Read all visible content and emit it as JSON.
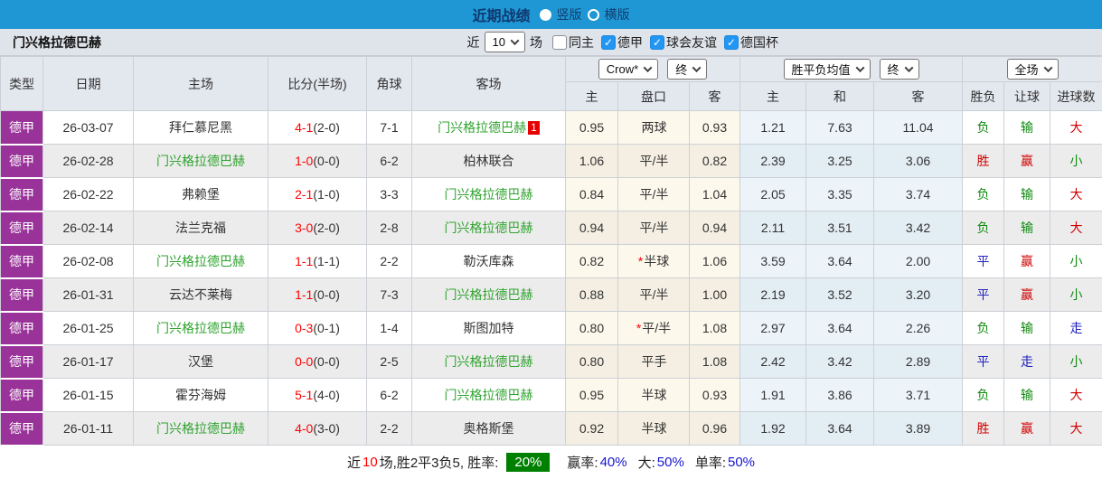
{
  "topbar": {
    "title": "近期战绩",
    "radios": [
      {
        "label": "竖版",
        "selected": true
      },
      {
        "label": "横版",
        "selected": false
      }
    ]
  },
  "toolbar": {
    "team": "门兴格拉德巴赫",
    "recent_prefix": "近",
    "recent_value": "10",
    "recent_suffix": "场",
    "checkboxes": [
      {
        "label": "同主",
        "checked": false
      },
      {
        "label": "德甲",
        "checked": true
      },
      {
        "label": "球会友谊",
        "checked": true
      },
      {
        "label": "德国杯",
        "checked": true
      }
    ]
  },
  "table": {
    "columns": {
      "type": "类型",
      "date": "日期",
      "home": "主场",
      "score": "比分(半场)",
      "corner": "角球",
      "away": "客场",
      "ah_home": "主",
      "ah_line": "盘口",
      "ah_away": "客",
      "eu_home": "主",
      "eu_draw": "和",
      "eu_away": "客",
      "result": "胜负",
      "handicap": "让球",
      "goals": "进球数"
    },
    "selects": {
      "odds_source": "Crow*",
      "odds_state": "终",
      "euro_label": "胜平负均值",
      "euro_state": "终",
      "scope": "全场"
    },
    "rows": [
      {
        "league": "德甲",
        "date": "26-03-07",
        "home": "拜仁慕尼黑",
        "home_green": false,
        "score": "4-1",
        "half": "(2-0)",
        "corner": "7-1",
        "away": "门兴格拉德巴赫",
        "away_green": true,
        "away_badge": "1",
        "ah_home": "0.95",
        "ah_star": false,
        "ah_line": "两球",
        "ah_away": "0.93",
        "eu_home": "1.21",
        "eu_draw": "7.63",
        "eu_away": "11.04",
        "result": "负",
        "result_color": "green",
        "handicap": "输",
        "handicap_color": "green",
        "goals": "大",
        "goals_color": "red"
      },
      {
        "league": "德甲",
        "date": "26-02-28",
        "home": "门兴格拉德巴赫",
        "home_green": true,
        "score": "1-0",
        "half": "(0-0)",
        "corner": "6-2",
        "away": "柏林联合",
        "away_green": false,
        "away_badge": "",
        "ah_home": "1.06",
        "ah_star": false,
        "ah_line": "平/半",
        "ah_away": "0.82",
        "eu_home": "2.39",
        "eu_draw": "3.25",
        "eu_away": "3.06",
        "result": "胜",
        "result_color": "red",
        "handicap": "赢",
        "handicap_color": "red",
        "goals": "小",
        "goals_color": "green"
      },
      {
        "league": "德甲",
        "date": "26-02-22",
        "home": "弗赖堡",
        "home_green": false,
        "score": "2-1",
        "half": "(1-0)",
        "corner": "3-3",
        "away": "门兴格拉德巴赫",
        "away_green": true,
        "away_badge": "",
        "ah_home": "0.84",
        "ah_star": false,
        "ah_line": "平/半",
        "ah_away": "1.04",
        "eu_home": "2.05",
        "eu_draw": "3.35",
        "eu_away": "3.74",
        "result": "负",
        "result_color": "green",
        "handicap": "输",
        "handicap_color": "green",
        "goals": "大",
        "goals_color": "red"
      },
      {
        "league": "德甲",
        "date": "26-02-14",
        "home": "法兰克福",
        "home_green": false,
        "score": "3-0",
        "half": "(2-0)",
        "corner": "2-8",
        "away": "门兴格拉德巴赫",
        "away_green": true,
        "away_badge": "",
        "ah_home": "0.94",
        "ah_star": false,
        "ah_line": "平/半",
        "ah_away": "0.94",
        "eu_home": "2.11",
        "eu_draw": "3.51",
        "eu_away": "3.42",
        "result": "负",
        "result_color": "green",
        "handicap": "输",
        "handicap_color": "green",
        "goals": "大",
        "goals_color": "red"
      },
      {
        "league": "德甲",
        "date": "26-02-08",
        "home": "门兴格拉德巴赫",
        "home_green": true,
        "score": "1-1",
        "half": "(1-1)",
        "corner": "2-2",
        "away": "勒沃库森",
        "away_green": false,
        "away_badge": "",
        "ah_home": "0.82",
        "ah_star": true,
        "ah_line": "半球",
        "ah_away": "1.06",
        "eu_home": "3.59",
        "eu_draw": "3.64",
        "eu_away": "2.00",
        "result": "平",
        "result_color": "blue",
        "handicap": "赢",
        "handicap_color": "red",
        "goals": "小",
        "goals_color": "green"
      },
      {
        "league": "德甲",
        "date": "26-01-31",
        "home": "云达不莱梅",
        "home_green": false,
        "score": "1-1",
        "half": "(0-0)",
        "corner": "7-3",
        "away": "门兴格拉德巴赫",
        "away_green": true,
        "away_badge": "",
        "ah_home": "0.88",
        "ah_star": false,
        "ah_line": "平/半",
        "ah_away": "1.00",
        "eu_home": "2.19",
        "eu_draw": "3.52",
        "eu_away": "3.20",
        "result": "平",
        "result_color": "blue",
        "handicap": "赢",
        "handicap_color": "red",
        "goals": "小",
        "goals_color": "green"
      },
      {
        "league": "德甲",
        "date": "26-01-25",
        "home": "门兴格拉德巴赫",
        "home_green": true,
        "score": "0-3",
        "half": "(0-1)",
        "corner": "1-4",
        "away": "斯图加特",
        "away_green": false,
        "away_badge": "",
        "ah_home": "0.80",
        "ah_star": true,
        "ah_line": "平/半",
        "ah_away": "1.08",
        "eu_home": "2.97",
        "eu_draw": "3.64",
        "eu_away": "2.26",
        "result": "负",
        "result_color": "green",
        "handicap": "输",
        "handicap_color": "green",
        "goals": "走",
        "goals_color": "blue"
      },
      {
        "league": "德甲",
        "date": "26-01-17",
        "home": "汉堡",
        "home_green": false,
        "score": "0-0",
        "half": "(0-0)",
        "corner": "2-5",
        "away": "门兴格拉德巴赫",
        "away_green": true,
        "away_badge": "",
        "ah_home": "0.80",
        "ah_star": false,
        "ah_line": "平手",
        "ah_away": "1.08",
        "eu_home": "2.42",
        "eu_draw": "3.42",
        "eu_away": "2.89",
        "result": "平",
        "result_color": "blue",
        "handicap": "走",
        "handicap_color": "blue",
        "goals": "小",
        "goals_color": "green"
      },
      {
        "league": "德甲",
        "date": "26-01-15",
        "home": "霍芬海姆",
        "home_green": false,
        "score": "5-1",
        "half": "(4-0)",
        "corner": "6-2",
        "away": "门兴格拉德巴赫",
        "away_green": true,
        "away_badge": "",
        "ah_home": "0.95",
        "ah_star": false,
        "ah_line": "半球",
        "ah_away": "0.93",
        "eu_home": "1.91",
        "eu_draw": "3.86",
        "eu_away": "3.71",
        "result": "负",
        "result_color": "green",
        "handicap": "输",
        "handicap_color": "green",
        "goals": "大",
        "goals_color": "red"
      },
      {
        "league": "德甲",
        "date": "26-01-11",
        "home": "门兴格拉德巴赫",
        "home_green": true,
        "score": "4-0",
        "half": "(3-0)",
        "corner": "2-2",
        "away": "奥格斯堡",
        "away_green": false,
        "away_badge": "",
        "ah_home": "0.92",
        "ah_star": false,
        "ah_line": "半球",
        "ah_away": "0.96",
        "eu_home": "1.92",
        "eu_draw": "3.64",
        "eu_away": "3.89",
        "result": "胜",
        "result_color": "red",
        "handicap": "赢",
        "handicap_color": "red",
        "goals": "大",
        "goals_color": "red"
      }
    ]
  },
  "footer": {
    "prefix": "近",
    "count": "10",
    "mid": "场,胜2平3负5, 胜率:",
    "rate_badge": "20%",
    "stats": [
      {
        "label": "赢率:",
        "value": "40%"
      },
      {
        "label": "大:",
        "value": "50%"
      },
      {
        "label": "单率:",
        "value": "50%"
      }
    ]
  },
  "colors": {
    "topbar_blue": "#1e97d4",
    "league_purple": "#993399",
    "win_red": "#d10000",
    "lose_green": "#0f8a0f",
    "draw_blue": "#2222bf",
    "rate_badge_green": "#008000",
    "team_green": "#2fa32f",
    "score_red": "#ff0000"
  }
}
